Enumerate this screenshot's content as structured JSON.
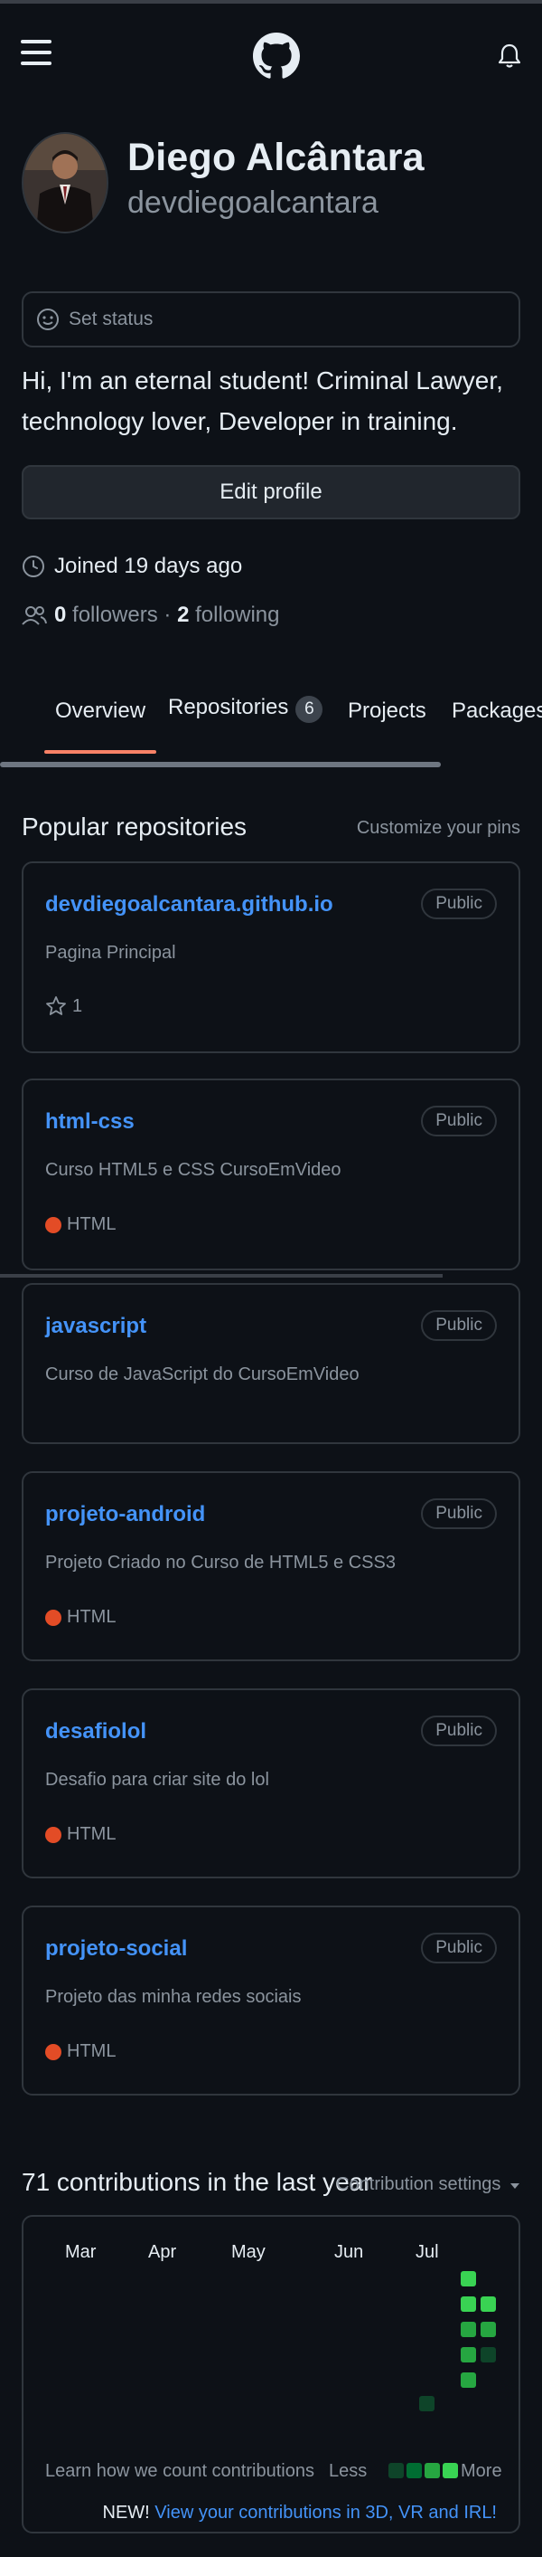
{
  "header": {
    "menu_icon": "hamburger-menu-icon",
    "logo_icon": "github-octocat-icon",
    "notification_icon": "bell-icon"
  },
  "profile": {
    "name": "Diego Alcântara",
    "login": "devdiegoalcantara",
    "status_label": "Set status",
    "bio": "Hi, I'm an eternal student! Criminal Lawyer, technology lover, Developer in training.",
    "edit_label": "Edit profile",
    "joined": "Joined 19 days ago",
    "followers_count": "0",
    "followers_label": "followers",
    "separator": "·",
    "following_count": "2",
    "following_label": "following"
  },
  "tabs": [
    {
      "label": "Overview"
    },
    {
      "label": "Repositories",
      "count": "6"
    },
    {
      "label": "Projects"
    },
    {
      "label": "Packages"
    }
  ],
  "popular": {
    "title": "Popular repositories",
    "customize": "Customize your pins"
  },
  "repos": [
    {
      "name": "devdiegoalcantara.github.io",
      "visibility": "Public",
      "description": "Pagina Principal",
      "stars": "1"
    },
    {
      "name": "html-css",
      "visibility": "Public",
      "description": "Curso HTML5 e CSS CursoEmVideo",
      "language": "HTML"
    },
    {
      "name": "javascript",
      "visibility": "Public",
      "description": "Curso de JavaScript do CursoEmVideo"
    },
    {
      "name": "projeto-android",
      "visibility": "Public",
      "description": "Projeto Criado no Curso de HTML5 e CSS3",
      "language": "HTML"
    },
    {
      "name": "desafiolol",
      "visibility": "Public",
      "description": "Desafio para criar site do lol",
      "language": "HTML"
    },
    {
      "name": "projeto-social",
      "visibility": "Public",
      "description": "Projeto das minha redes sociais",
      "language": "HTML"
    }
  ],
  "contributions": {
    "title": "71 contributions in the last year",
    "settings": "Contribution settings",
    "months": [
      "Mar",
      "Apr",
      "May",
      "Jun",
      "Jul"
    ],
    "learn": "Learn how we count contributions",
    "less": "Less",
    "more": "More",
    "new_prefix": "NEW!",
    "new_link": "View your contributions in 3D, VR and IRL!"
  },
  "colors": {
    "background": "#0d1117",
    "link": "#4493f8",
    "tab_underline": "#f78166",
    "html_language": "#e34c26"
  }
}
